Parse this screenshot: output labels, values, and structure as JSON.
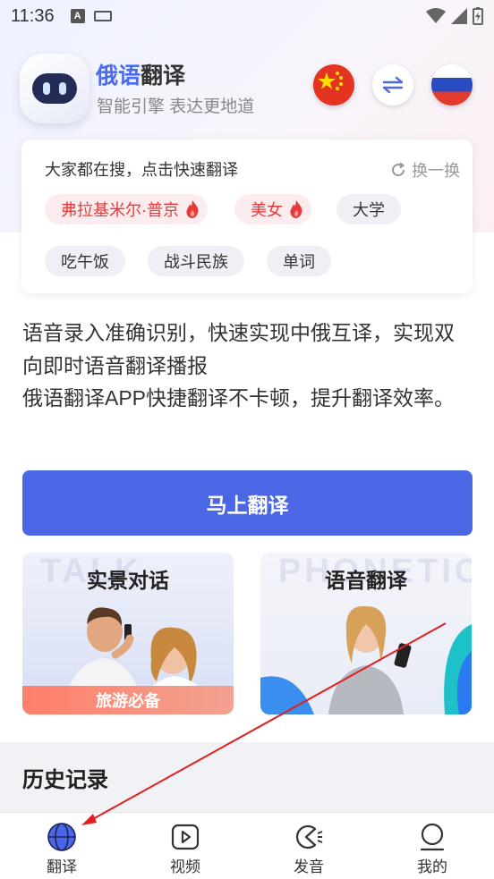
{
  "status_bar": {
    "time": "11:36",
    "a_badge": "A"
  },
  "header": {
    "title_part1": "俄语",
    "title_part2": "翻译",
    "subtitle": "智能引擎 表达更地道",
    "source_flag": "china-flag-icon",
    "target_flag": "russia-flag-icon"
  },
  "search_card": {
    "title": "大家都在搜，点击快速翻译",
    "refresh_label": "换一换",
    "chips": [
      {
        "label": "弗拉基米尔·普京",
        "hot": true
      },
      {
        "label": "美女",
        "hot": true
      },
      {
        "label": "大学",
        "hot": false
      },
      {
        "label": "吃午饭",
        "hot": false
      },
      {
        "label": "战斗民族",
        "hot": false
      },
      {
        "label": "单词",
        "hot": false
      }
    ]
  },
  "description": {
    "line1": "语音录入准确识别，快速实现中俄互译，实现双向即时语音翻译播报",
    "line2": "俄语翻译APP快捷翻译不卡顿，提升翻译效率。"
  },
  "cta_label": "马上翻译",
  "features": [
    {
      "title": "实景对话",
      "watermark": "TALK",
      "tag": "旅游必备"
    },
    {
      "title": "语音翻译",
      "watermark": "PHONETIC",
      "tag": ""
    }
  ],
  "history": {
    "title": "历史记录"
  },
  "bottom_nav": [
    {
      "label": "翻译",
      "icon": "globe-icon"
    },
    {
      "label": "视频",
      "icon": "video-play-icon"
    },
    {
      "label": "发音",
      "icon": "pronunciation-icon"
    },
    {
      "label": "我的",
      "icon": "profile-icon"
    }
  ],
  "colors": {
    "accent": "#4b67e6",
    "hot": "#e63a3a",
    "annotation": "#e02020"
  }
}
